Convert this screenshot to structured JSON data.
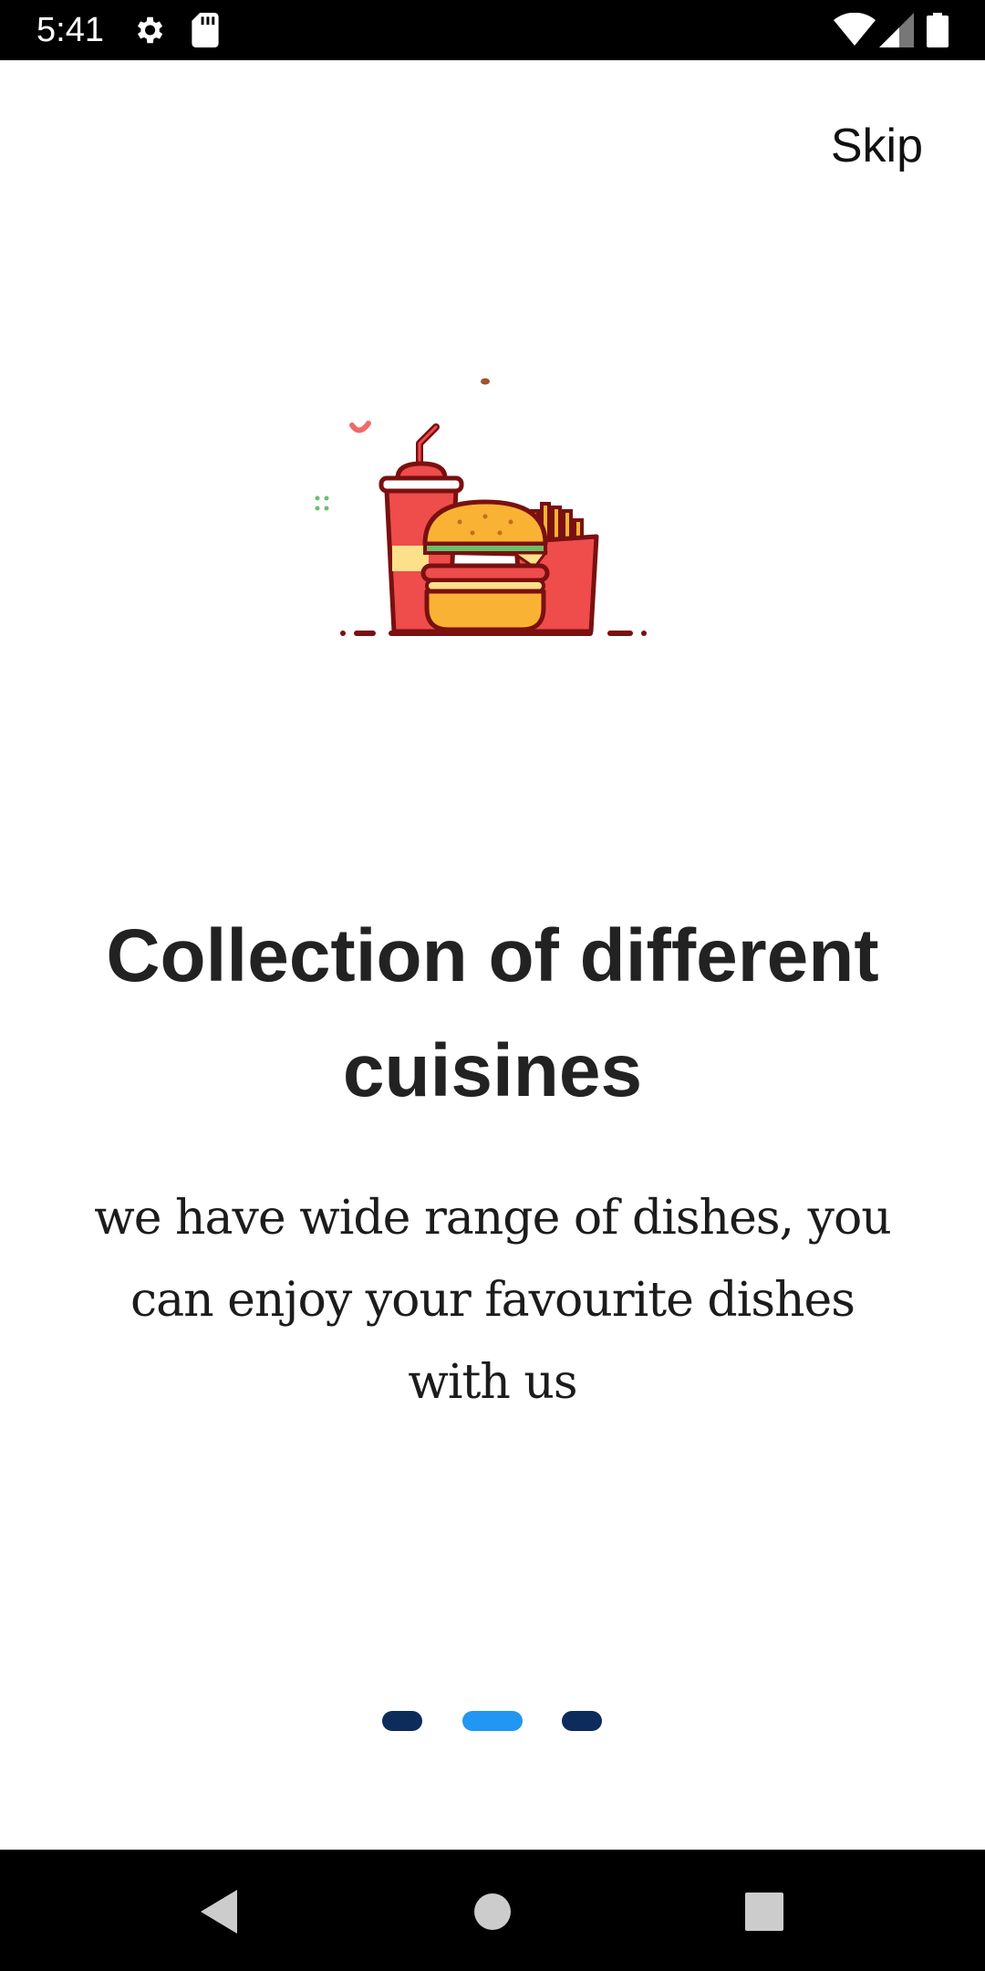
{
  "status_bar": {
    "time": "5:41",
    "icons": [
      "gear-icon",
      "sd-card-icon",
      "wifi-icon",
      "signal-icon",
      "battery-icon"
    ]
  },
  "header": {
    "skip_label": "Skip"
  },
  "onboarding": {
    "illustration": "fast-food-icon",
    "title": "Collection of different cuisines",
    "description": "we have wide range of dishes, you can enjoy your favourite dishes with us"
  },
  "page_indicator": {
    "pages": 3,
    "current": 2,
    "active_color": "#2196F3",
    "inactive_color": "#0D2C5C"
  },
  "nav_bar": {
    "buttons": [
      "back-icon",
      "home-icon",
      "recents-icon"
    ]
  }
}
